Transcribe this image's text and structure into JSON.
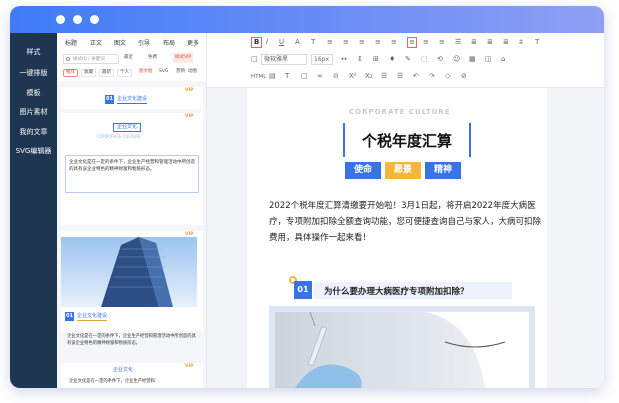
{
  "sidebar": {
    "items": [
      {
        "label": "样式"
      },
      {
        "label": "一键排版"
      },
      {
        "label": "模板"
      },
      {
        "label": "图片素材"
      },
      {
        "label": "我的文章"
      },
      {
        "label": "SVG编辑器"
      }
    ]
  },
  "panel": {
    "tabs": [
      "标题",
      "正文",
      "图文",
      "引导",
      "布局",
      "更多"
    ],
    "search_placeholder": "样式ID / 关键词",
    "filters": [
      "最近",
      "免费",
      "样式VIP"
    ],
    "chips": [
      "推荐",
      "收藏",
      "最新",
      "个人",
      "图文框",
      "SVG",
      "营销",
      "动图"
    ],
    "card1": {
      "num": "01",
      "title": "企业文化建设",
      "vip": "VIP"
    },
    "card2": {
      "title": "企业文化",
      "subtitle": "CORPORATE CULTURE",
      "text": "企业文化是在一定的条件下，企业生产经营和管理活动中所创造的具有该企业特色的精神财富和物质形态。",
      "vip": "VIP"
    },
    "card3": {
      "num": "01",
      "title": "企业文化建设",
      "text": "企业文化是在一定的条件下，企业生产经营和管理活动中所创造的具有该企业特色的精神财富和物质形态。",
      "vip": "VIP"
    },
    "card4": {
      "title": "企业文化",
      "text": "企业文化是在一定的条件下，企业生产经营和",
      "vip": "VIP"
    }
  },
  "toolbar": {
    "font_family": "微软雅黑",
    "font_size": "16px",
    "row1": [
      "B",
      "I",
      "U",
      "A",
      "T",
      "≡",
      "≡",
      "≡",
      "≡",
      "≡",
      "≡",
      "≡",
      "≡",
      "☰",
      "≣",
      "≣",
      "≣",
      "⩲",
      "T"
    ],
    "row2": [
      "□",
      "微软雅黑",
      "16px",
      "↔",
      "↕",
      "⊞",
      "♦",
      "✎",
      "⬚",
      "⟲",
      "☺",
      "▦",
      "◫",
      "⌂"
    ],
    "row3": [
      "HTML",
      "▤",
      "T",
      "□",
      "∞",
      "⊝",
      "X²",
      "X₂",
      "☰",
      "☰",
      "↶",
      "↷",
      "◇",
      "⊘"
    ]
  },
  "article": {
    "header_sub": "CORPORATE CULTURE",
    "title": "个税年度汇算",
    "tags": [
      "使命",
      "愿景",
      "精神"
    ],
    "tag_colors": [
      "#3873e8",
      "#f4b73c",
      "#3873e8"
    ],
    "body": "2022个税年度汇算清缴要开始啦！3月1日起，将开启2022年度大病医疗，专项附加扣除全额查询功能，您可便捷查询自己与家人，大病可扣除费用，具体操作一起来看！",
    "section_num": "01",
    "section_title": "为什么要办理大病医疗专项附加扣除？"
  },
  "colors": {
    "accent": "#3873e8",
    "sidebar": "#1f3653",
    "titlebar": "#5b86f4",
    "vip": "#e6a23c"
  }
}
